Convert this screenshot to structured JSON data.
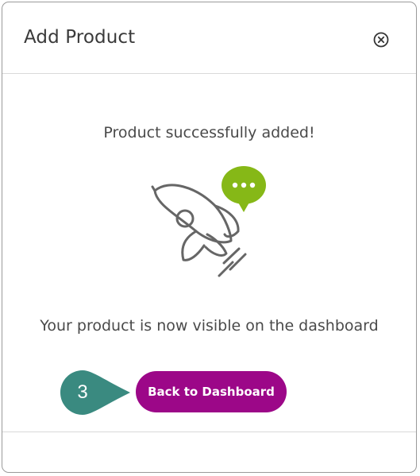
{
  "modal": {
    "title": "Add Product",
    "success_message": "Product successfully added!",
    "visible_message": "Your product is now visible on the dashboard",
    "primary_button": "Back to Dashboard",
    "step_number": "3"
  },
  "icons": {
    "close": "close-circle-icon",
    "rocket": "rocket-icon",
    "chat": "chat-bubble-icon"
  },
  "colors": {
    "brand_purple": "#9c0788",
    "chat_green": "#86b817",
    "step_teal": "#3a8a80",
    "text": "#4a4a4a"
  }
}
